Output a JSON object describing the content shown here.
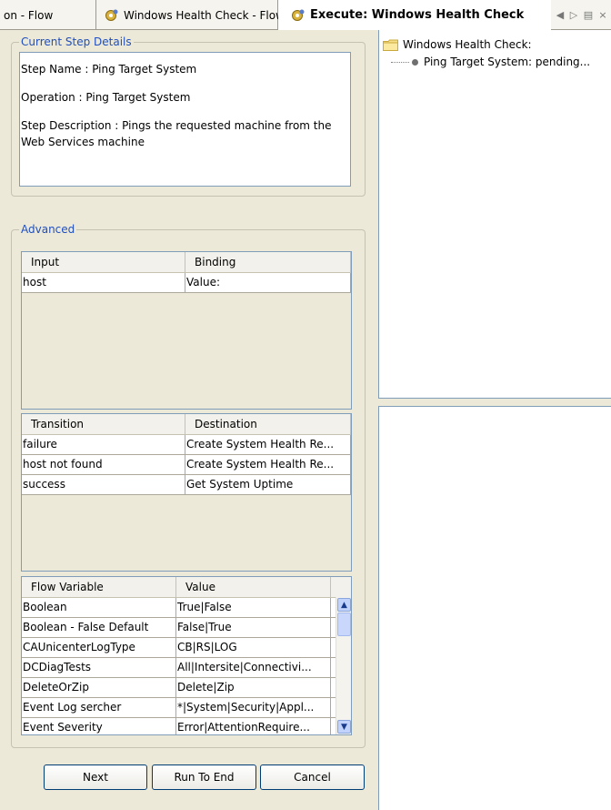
{
  "tabs": [
    {
      "label": "on - Flow"
    },
    {
      "label": "Windows Health Check - Flow"
    },
    {
      "label": "Execute: Windows Health Check"
    }
  ],
  "tab_controls": {
    "prev": "◀",
    "next": "▷",
    "list": "▤",
    "close": "×"
  },
  "current_step": {
    "legend": "Current Step Details",
    "step_name": "Step Name : Ping Target System",
    "operation": "Operation : Ping Target System",
    "description": "Step Description : Pings the requested machine from the Web Services machine"
  },
  "advanced": {
    "legend": "Advanced",
    "inputs": {
      "headers": [
        "Input",
        "Binding"
      ],
      "rows": [
        [
          "host",
          "Value:"
        ]
      ]
    },
    "transitions": {
      "headers": [
        "Transition",
        "Destination"
      ],
      "rows": [
        [
          "failure",
          "Create System Health Re..."
        ],
        [
          "host not found",
          "Create System Health Re..."
        ],
        [
          "success",
          "Get System Uptime"
        ]
      ]
    },
    "flow_variables": {
      "headers": [
        "Flow Variable",
        "Value"
      ],
      "rows": [
        [
          "Boolean",
          "True|False"
        ],
        [
          "Boolean - False Default",
          "False|True"
        ],
        [
          "CAUnicenterLogType",
          "CB|RS|LOG"
        ],
        [
          "DCDiagTests",
          "All|Intersite|Connectivi..."
        ],
        [
          "DeleteOrZip",
          "Delete|Zip"
        ],
        [
          "Event Log sercher",
          "*|System|Security|Appl..."
        ],
        [
          "Event Severity",
          "Error|AttentionRequire..."
        ]
      ]
    }
  },
  "buttons": {
    "next": "Next",
    "run_to_end": "Run To End",
    "cancel": "Cancel"
  },
  "tree": {
    "root": "Windows Health Check:",
    "child": "Ping Target System: pending..."
  },
  "colors": {
    "legend": "#1f4fbf",
    "window_bg": "#ece9d8",
    "border": "#7f9db9"
  }
}
